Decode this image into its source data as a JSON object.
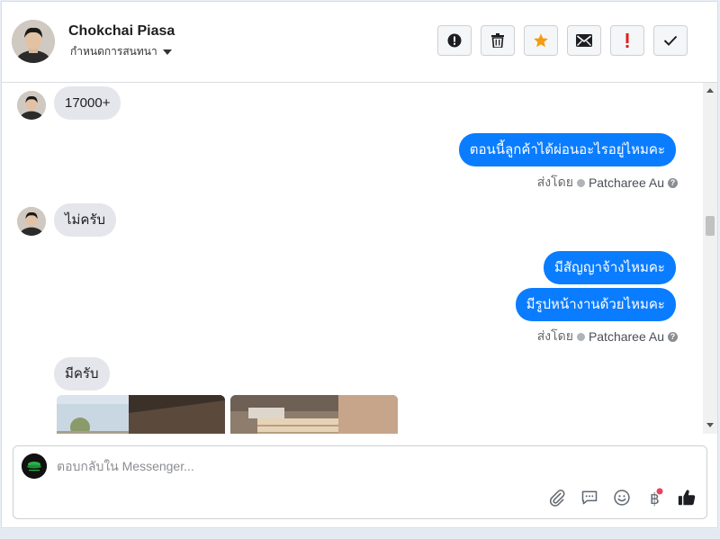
{
  "header": {
    "contact_name": "Chokchai Piasa",
    "assign_label": "กำหนดการสนทนา",
    "toolbar": [
      {
        "name": "spam-button",
        "icon": "alert-circle-icon"
      },
      {
        "name": "delete-button",
        "icon": "trash-icon"
      },
      {
        "name": "star-button",
        "icon": "star-icon"
      },
      {
        "name": "mark-unread-button",
        "icon": "envelope-icon"
      },
      {
        "name": "follow-up-button",
        "icon": "exclamation-icon"
      },
      {
        "name": "mark-done-button",
        "icon": "checkmark-icon"
      }
    ]
  },
  "thread": {
    "messages": [
      {
        "dir": "in",
        "text": "17000+"
      },
      {
        "dir": "out",
        "text": "ตอนนี้ลูกค้าได้ผ่อนอะไรอยู่ไหมคะ"
      },
      {
        "dir": "in",
        "text": "ไม่ครับ"
      },
      {
        "dir": "out",
        "text": "มีสัญญาจ้างไหมคะ"
      },
      {
        "dir": "out",
        "text": "มีรูปหน้างานด้วยไหมคะ"
      },
      {
        "dir": "in",
        "text": "มีครับ"
      }
    ],
    "sent_by_label": "ส่งโดย",
    "sender_name": "Patcharee Au"
  },
  "composer": {
    "placeholder": "ตอบกลับใน Messenger...",
    "icons": [
      "paperclip-icon",
      "chat-bubble-icon",
      "smiley-icon",
      "baht-icon",
      "thumbs-up-icon"
    ]
  },
  "colors": {
    "outgoing_bubble": "#0a7cff",
    "incoming_bubble": "#e4e6eb",
    "star": "#f39c12",
    "flag": "#e02020"
  }
}
